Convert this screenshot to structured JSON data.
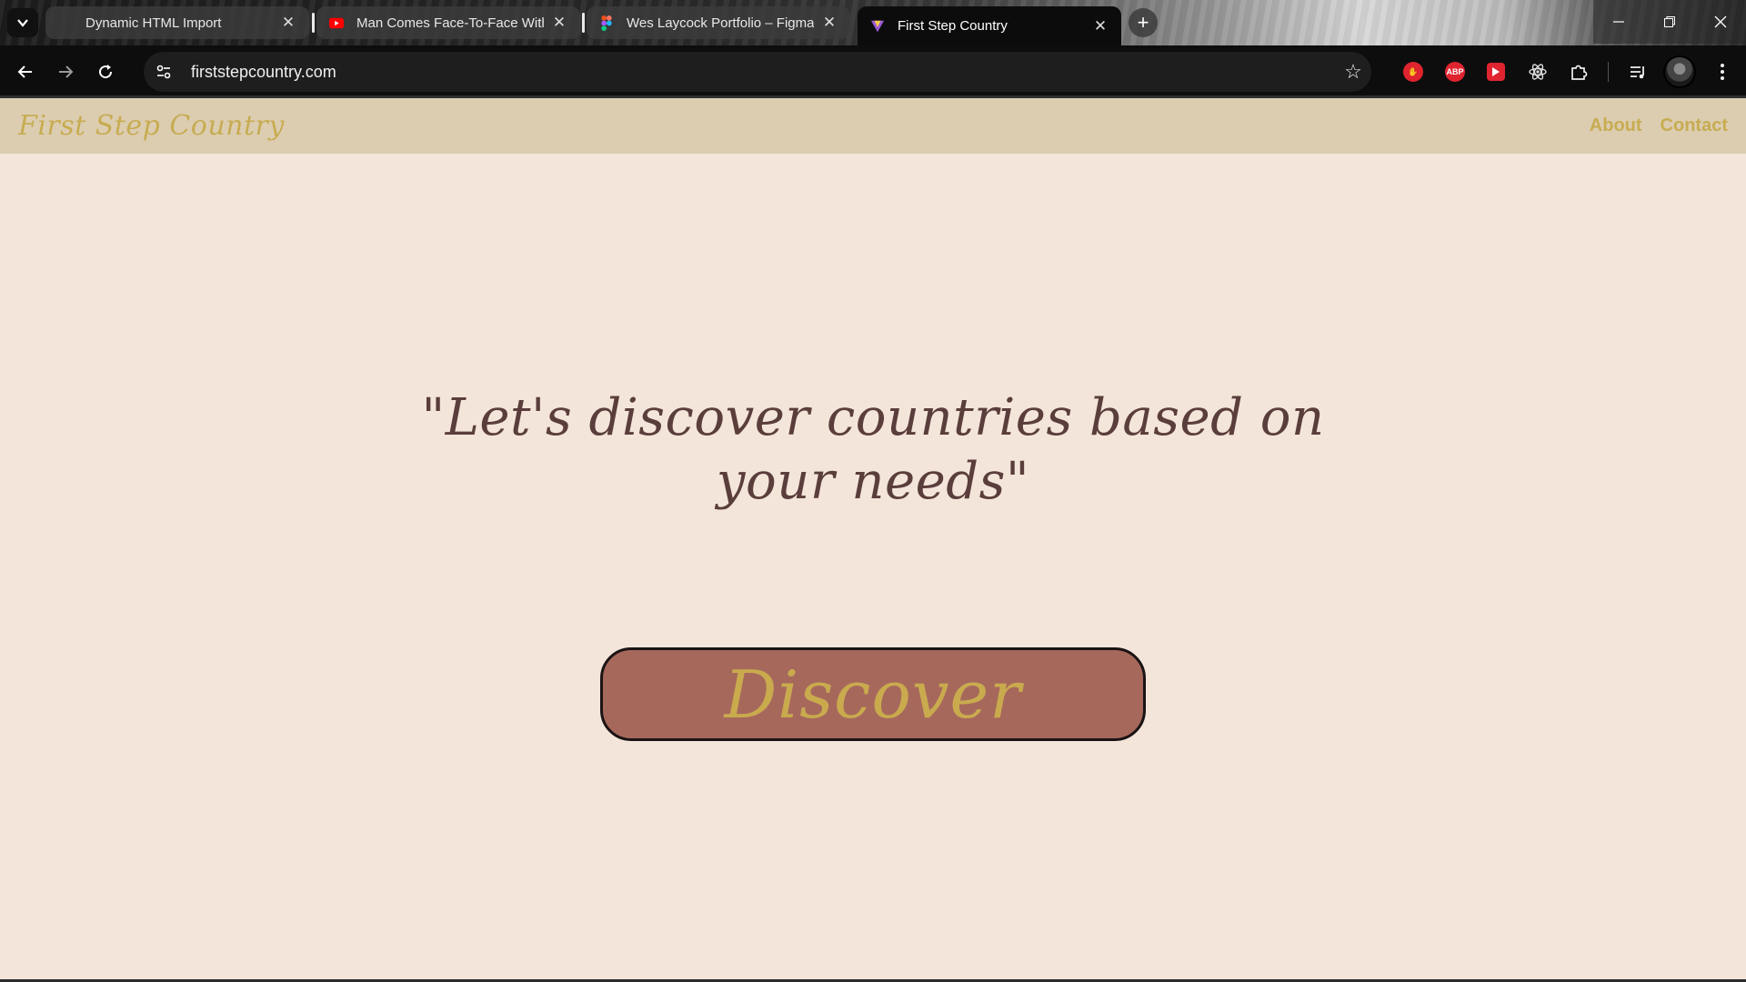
{
  "browser": {
    "tabs": [
      {
        "title": "Dynamic HTML Import",
        "favicon": "blank-icon"
      },
      {
        "title": "Man Comes Face-To-Face With",
        "favicon": "youtube-icon"
      },
      {
        "title": "Wes Laycock Portfolio – Figma",
        "favicon": "figma-icon"
      },
      {
        "title": "First Step Country",
        "favicon": "site-icon",
        "active": true
      }
    ],
    "url": "firststepcountry.com",
    "extensions": [
      "hand-stop-icon",
      "adblock-icon",
      "red-play-icon",
      "atom-icon",
      "puzzle-icon",
      "media-queue-icon"
    ]
  },
  "site": {
    "logo": "First Step Country",
    "nav": {
      "about": "About",
      "contact": "Contact"
    },
    "quote": "\"Let's discover countries based on your needs\"",
    "cta": "Discover"
  },
  "colors": {
    "page_bg": "#f4e5da",
    "header_bg": "#dccdb1",
    "gold": "#c7ac51",
    "quote": "#5a3e3b",
    "button": "#a7685c"
  }
}
